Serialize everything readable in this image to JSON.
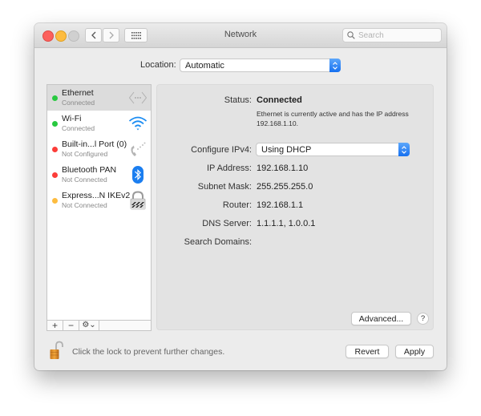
{
  "window": {
    "title": "Network",
    "search_placeholder": "Search"
  },
  "location": {
    "label": "Location:",
    "value": "Automatic"
  },
  "services": [
    {
      "name": "Ethernet",
      "status": "Connected",
      "status_color": "#28c940",
      "icon": "ethernet-icon",
      "selected": true
    },
    {
      "name": "Wi-Fi",
      "status": "Connected",
      "status_color": "#28c940",
      "icon": "wifi-icon",
      "selected": false
    },
    {
      "name": "Built-in...l Port (0)",
      "status": "Not Configured",
      "status_color": "#fc3d39",
      "icon": "phone-icon",
      "selected": false
    },
    {
      "name": "Bluetooth PAN",
      "status": "Not Connected",
      "status_color": "#fc3d39",
      "icon": "bluetooth-icon",
      "selected": false
    },
    {
      "name": "Express...N IKEv2",
      "status": "Not Connected",
      "status_color": "#fdbc40",
      "icon": "vpn-lock-icon",
      "selected": false
    }
  ],
  "sidebar_controls": {
    "add": "+",
    "remove": "−",
    "action": "⚙⌄"
  },
  "details": {
    "status_label": "Status:",
    "status_value": "Connected",
    "status_description": "Ethernet is currently active and has the IP address 192.168.1.10.",
    "configure_label": "Configure IPv4:",
    "configure_value": "Using DHCP",
    "ip_label": "IP Address:",
    "ip_value": "192.168.1.10",
    "subnet_label": "Subnet Mask:",
    "subnet_value": "255.255.255.0",
    "router_label": "Router:",
    "router_value": "192.168.1.1",
    "dns_label": "DNS Server:",
    "dns_value": "1.1.1.1, 1.0.0.1",
    "domains_label": "Search Domains:",
    "domains_value": "",
    "advanced_button": "Advanced...",
    "help_button": "?"
  },
  "footer": {
    "lock_text": "Click the lock to prevent further changes.",
    "revert_button": "Revert",
    "apply_button": "Apply"
  }
}
